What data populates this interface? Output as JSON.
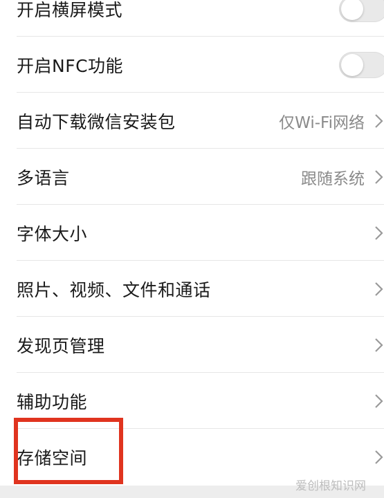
{
  "settings": {
    "items": [
      {
        "label": "开启横屏模式",
        "type": "toggle",
        "on": false
      },
      {
        "label": "开启NFC功能",
        "type": "toggle",
        "on": false
      },
      {
        "label": "自动下载微信安装包",
        "type": "link",
        "value": "仅Wi-Fi网络"
      },
      {
        "label": "多语言",
        "type": "link",
        "value": "跟随系统"
      },
      {
        "label": "字体大小",
        "type": "link",
        "value": ""
      },
      {
        "label": "照片、视频、文件和通话",
        "type": "link",
        "value": ""
      },
      {
        "label": "发现页管理",
        "type": "link",
        "value": ""
      },
      {
        "label": "辅助功能",
        "type": "link",
        "value": ""
      },
      {
        "label": "存储空间",
        "type": "link",
        "value": ""
      }
    ]
  },
  "annotation": {
    "highlight_color": "#e0341f"
  },
  "watermark": {
    "text": "爱创根知识网"
  },
  "colors": {
    "label": "#1a1a1a",
    "value": "#8a8a8a",
    "toggle_off": "#e9e9e9"
  }
}
